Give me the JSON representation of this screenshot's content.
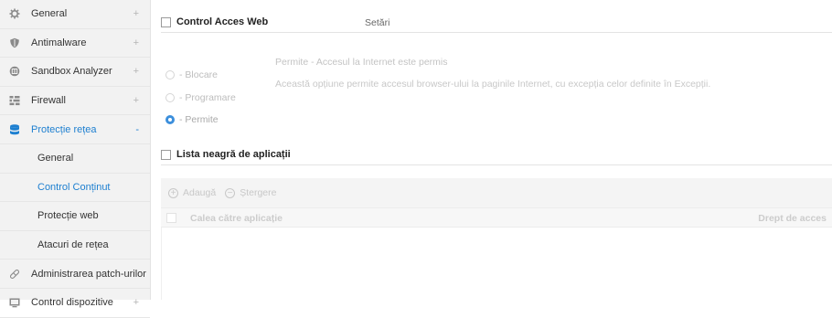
{
  "sidebar": {
    "items": [
      {
        "label": "General",
        "icon": "gear-icon",
        "expand": "+"
      },
      {
        "label": "Antimalware",
        "icon": "shield-icon",
        "expand": "+"
      },
      {
        "label": "Sandbox Analyzer",
        "icon": "sandbox-icon",
        "expand": "+"
      },
      {
        "label": "Firewall",
        "icon": "firewall-icon",
        "expand": "+"
      },
      {
        "label": "Protecție rețea",
        "icon": "network-protection-icon",
        "expand": "-"
      }
    ],
    "sub_items": [
      {
        "label": "General"
      },
      {
        "label": "Control Conținut"
      },
      {
        "label": "Protecție web"
      },
      {
        "label": "Atacuri de rețea"
      }
    ],
    "bottom_items": [
      {
        "label": "Administrarea patch-urilor",
        "icon": "patch-icon",
        "expand": ""
      },
      {
        "label": "Control dispozitive",
        "icon": "device-icon",
        "expand": "+"
      }
    ]
  },
  "web_access": {
    "title": "Control Acces Web",
    "settings_label": "Setări",
    "options": [
      {
        "label": "- Blocare",
        "checked": false
      },
      {
        "label": "- Programare",
        "checked": false
      },
      {
        "label": "- Permite",
        "checked": true
      }
    ],
    "description_title": "Permite - Accesul la Internet este permis",
    "description_text": "Această opțiune permite accesul browser-ului la paginile Internet, cu excepția celor definite în Excepții."
  },
  "blacklist": {
    "title": "Lista neagră de aplicații",
    "toolbar": {
      "add": "Adaugă",
      "delete": "Ștergere"
    },
    "columns": {
      "path": "Calea către aplicație",
      "access": "Drept de acces"
    }
  },
  "colors": {
    "accent": "#1d7fd0",
    "radio_checked": "#3c8fdc"
  }
}
